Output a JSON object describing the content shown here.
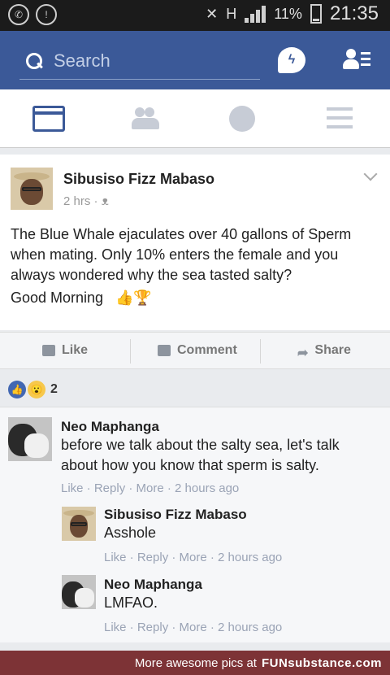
{
  "status_bar": {
    "battery": "11%",
    "time": "21:35",
    "network": "H"
  },
  "search": {
    "placeholder": "Search"
  },
  "tabs": [
    "newsfeed-icon",
    "friends-icon",
    "globe-icon",
    "menu-icon"
  ],
  "post": {
    "author": "Sibusiso Fizz Mabaso",
    "time": "2 hrs",
    "text": "The Blue Whale ejaculates over 40 gallons of Sperm when mating. Only 10% enters the female and you always wondered why the sea tasted salty?",
    "good_morning": "Good Morning",
    "emojis": "👍🏆"
  },
  "actions": {
    "like": "Like",
    "comment": "Comment",
    "share": "Share"
  },
  "reactions": {
    "count": "2"
  },
  "comments": [
    {
      "name": "Neo Maphanga",
      "text_line1": "before we talk about the salty sea, let's talk",
      "text_line2": "about how you know that sperm is salty.",
      "meta": "Like · Reply · More · 2 hours ago"
    },
    {
      "name": "Sibusiso Fizz Mabaso",
      "text": "Asshole",
      "meta": "Like · Reply · More · 2 hours ago"
    },
    {
      "name": "Neo Maphanga",
      "text": "LMFAO.",
      "meta": "Like · Reply · More · 2 hours ago"
    }
  ],
  "footer": {
    "text": "More awesome pics at",
    "brand": "FUNsubstance.com"
  },
  "colors": {
    "brand_blue": "#3b5998",
    "footer": "#7d3336"
  }
}
